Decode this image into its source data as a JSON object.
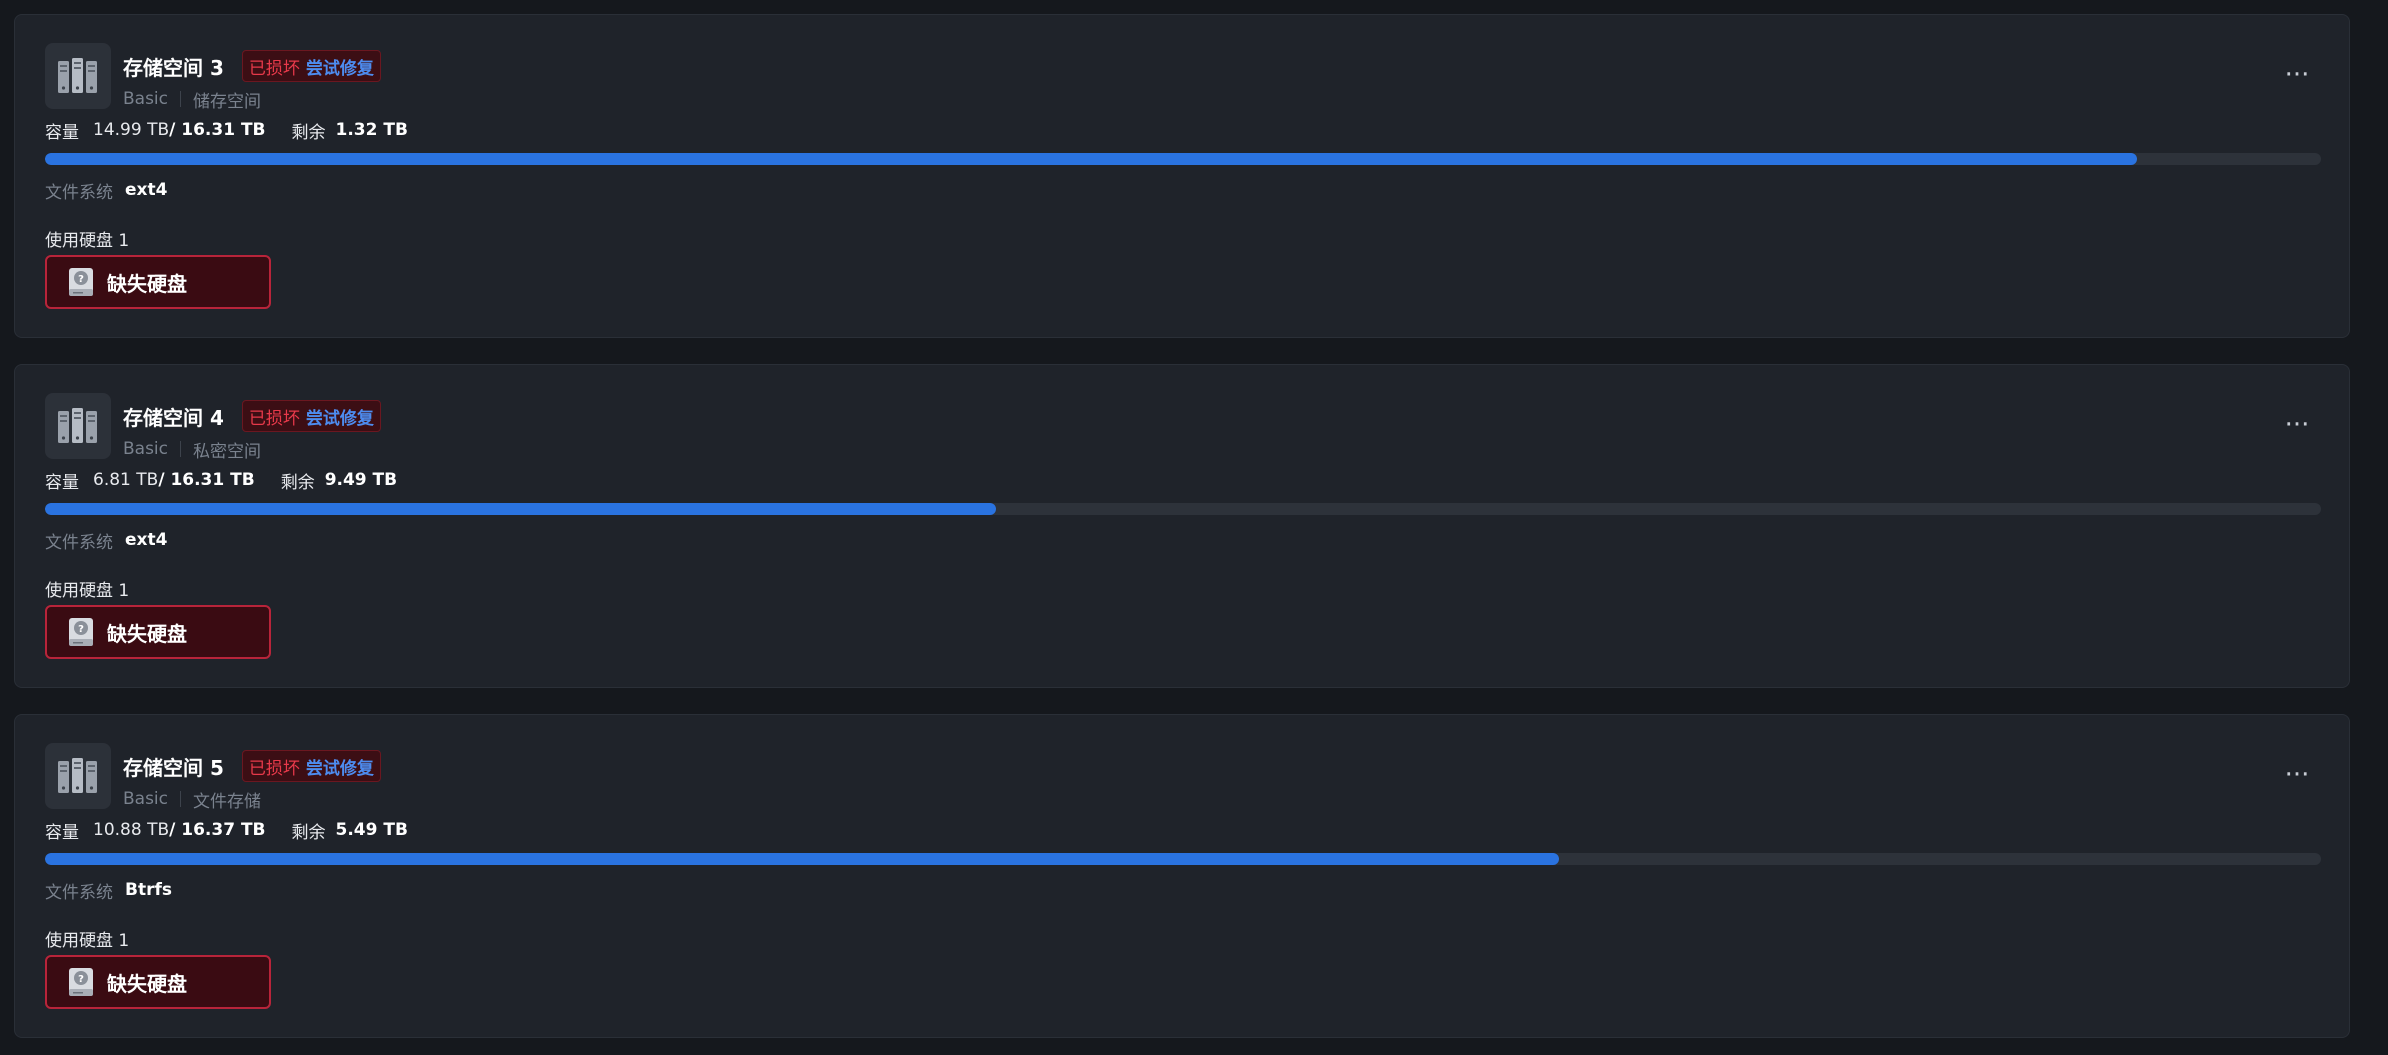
{
  "pools": [
    {
      "title": "存储空间 3",
      "status_label": "已损坏",
      "repair_label": "尝试修复",
      "raid_type": "Basic",
      "volume_name": "储存空间",
      "capacity_label": "容量",
      "used": "14.99 TB",
      "total": "/ 16.31 TB",
      "free_label": "剩余",
      "free": "1.32 TB",
      "usage_fraction": 0.919,
      "fs_label": "文件系统",
      "fs_type": "ext4",
      "disks_label": "使用硬盘 1",
      "missing_label": "缺失硬盘",
      "more_label": "···"
    },
    {
      "title": "存储空间 4",
      "status_label": "已损坏",
      "repair_label": "尝试修复",
      "raid_type": "Basic",
      "volume_name": "私密空间",
      "capacity_label": "容量",
      "used": "6.81 TB",
      "total": "/ 16.31 TB",
      "free_label": "剩余",
      "free": "9.49 TB",
      "usage_fraction": 0.418,
      "fs_label": "文件系统",
      "fs_type": "ext4",
      "disks_label": "使用硬盘 1",
      "missing_label": "缺失硬盘",
      "more_label": "···"
    },
    {
      "title": "存储空间 5",
      "status_label": "已损坏",
      "repair_label": "尝试修复",
      "raid_type": "Basic",
      "volume_name": "文件存储",
      "capacity_label": "容量",
      "used": "10.88 TB",
      "total": "/ 16.37 TB",
      "free_label": "剩余",
      "free": "5.49 TB",
      "usage_fraction": 0.665,
      "fs_label": "文件系统",
      "fs_type": "Btrfs",
      "disks_label": "使用硬盘 1",
      "missing_label": "缺失硬盘",
      "more_label": "···"
    }
  ],
  "icons": {
    "pool": "storage-pool-icon",
    "missing_disk": "missing-disk-icon",
    "more": "more-options-icon"
  },
  "colors": {
    "accent": "#2a73e0",
    "danger": "#e8394a",
    "repair_link": "#4d8cf0"
  }
}
